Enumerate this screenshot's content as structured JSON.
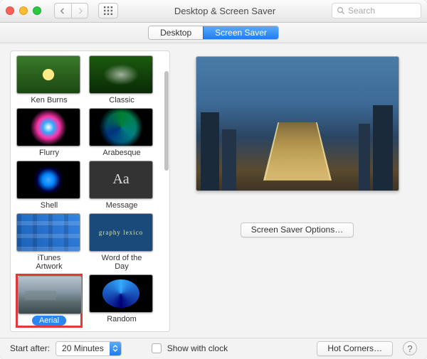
{
  "window": {
    "title": "Desktop & Screen Saver"
  },
  "search": {
    "placeholder": "Search"
  },
  "tabs": {
    "desktop": "Desktop",
    "screensaver": "Screen Saver"
  },
  "savers": [
    {
      "label": "Ken Burns"
    },
    {
      "label": "Classic"
    },
    {
      "label": "Flurry"
    },
    {
      "label": "Arabesque"
    },
    {
      "label": "Shell"
    },
    {
      "label": "Message"
    },
    {
      "label": "iTunes Artwork"
    },
    {
      "label": "Word of the Day"
    },
    {
      "label": "Aerial",
      "selected": true,
      "highlighted": true
    },
    {
      "label": "Random"
    }
  ],
  "message_glyph": "Aa",
  "word_glyph": "graphy lexico",
  "options_button": "Screen Saver Options…",
  "bottom": {
    "start_after_label": "Start after:",
    "start_after_value": "20 Minutes",
    "show_with_clock": "Show with clock",
    "hot_corners": "Hot Corners…"
  },
  "colors": {
    "accent": "#2a86f5",
    "highlight_box": "#e3393a"
  }
}
